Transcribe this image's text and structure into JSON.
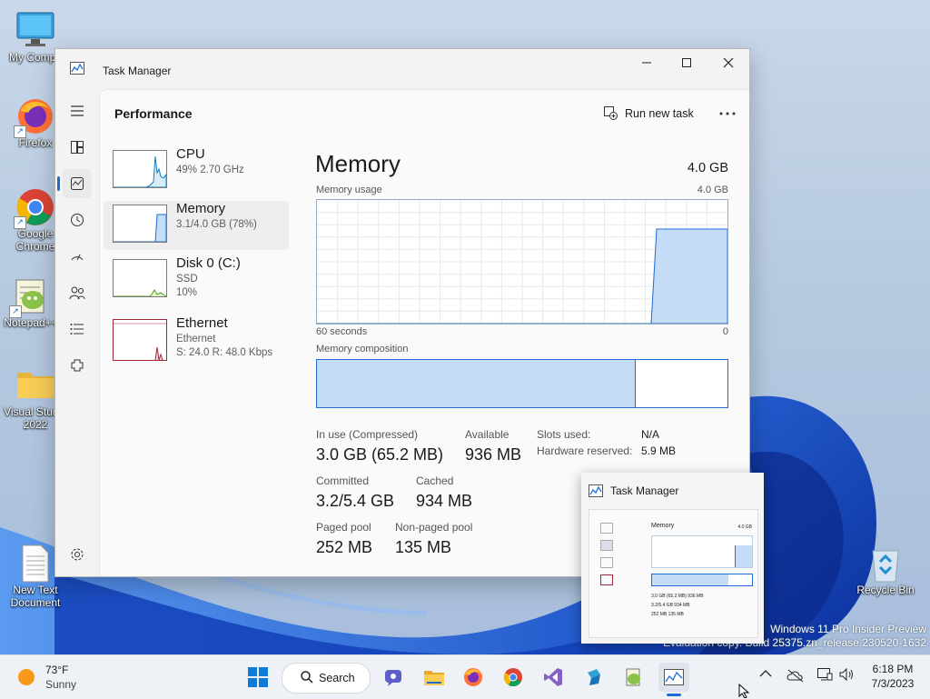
{
  "desktop": {
    "icons": [
      {
        "label": "My Compu"
      },
      {
        "label": "Firefox"
      },
      {
        "label": "Google Chrome"
      },
      {
        "label": "Notepad++"
      },
      {
        "label": "Visual Studio 2022"
      },
      {
        "label": "New Text Document"
      },
      {
        "label": "Recycle Bin"
      }
    ],
    "watermark": {
      "line1": "Windows 11 Pro Insider Preview",
      "line2": "Evaluation copy. Build 25375.zn_release.230520-1632"
    }
  },
  "window": {
    "title": "Task Manager",
    "page_title": "Performance",
    "run_new_task": "Run new task",
    "nav_icons": [
      "hamburger-icon",
      "processes-icon",
      "performance-icon",
      "app-history-icon",
      "startup-apps-icon",
      "users-icon",
      "details-icon",
      "services-icon",
      "settings-icon"
    ],
    "resources": [
      {
        "name": "CPU",
        "sub1": "49%  2.70 GHz",
        "sub2": ""
      },
      {
        "name": "Memory",
        "sub1": "3.1/4.0 GB (78%)",
        "sub2": ""
      },
      {
        "name": "Disk 0 (C:)",
        "sub1": "SSD",
        "sub2": "10%"
      },
      {
        "name": "Ethernet",
        "sub1": "Ethernet",
        "sub2": "S: 24.0  R: 48.0 Kbps"
      }
    ],
    "memory": {
      "title": "Memory",
      "total": "4.0 GB",
      "usage_label": "Memory usage",
      "usage_max": "4.0 GB",
      "time_left": "60 seconds",
      "time_right": "0",
      "composition_label": "Memory composition",
      "in_use_fraction": 0.765,
      "modified_fraction": 0.008,
      "stats": {
        "in_use_label": "In use (Compressed)",
        "in_use": "3.0 GB (65.2 MB)",
        "available_label": "Available",
        "available": "936 MB",
        "committed_label": "Committed",
        "committed": "3.2/5.4 GB",
        "cached_label": "Cached",
        "cached": "934 MB",
        "paged_label": "Paged pool",
        "paged": "252 MB",
        "nonpaged_label": "Non-paged pool",
        "nonpaged": "135 MB",
        "slots_label": "Slots used:",
        "slots": "N/A",
        "hw_label": "Hardware reserved:",
        "hw": "5.9 MB"
      }
    }
  },
  "preview": {
    "title": "Task Manager",
    "mini_title": "Memory",
    "mini_total": "4.0 GB",
    "mini_stats": [
      "3.0 GB (65.2 MB)",
      "936 MB",
      "3.2/5.4 GB",
      "934 MB",
      "252 MB",
      "135 MB"
    ]
  },
  "taskbar": {
    "weather_temp": "73°F",
    "weather_desc": "Sunny",
    "search": "Search",
    "time": "6:18 PM",
    "date": "7/3/2023",
    "apps": [
      "start-icon",
      "teams-icon",
      "file-explorer-icon",
      "firefox-icon",
      "chrome-icon",
      "visual-studio-icon",
      "azure-data-studio-icon",
      "notepadpp-icon",
      "task-manager-icon"
    ]
  },
  "colors": {
    "accent": "#1e6cd6",
    "memory_fill": "#c5dcf7",
    "cpu_line": "#117dbb",
    "disk_line": "#4da60c",
    "net_line": "#a7273a"
  }
}
